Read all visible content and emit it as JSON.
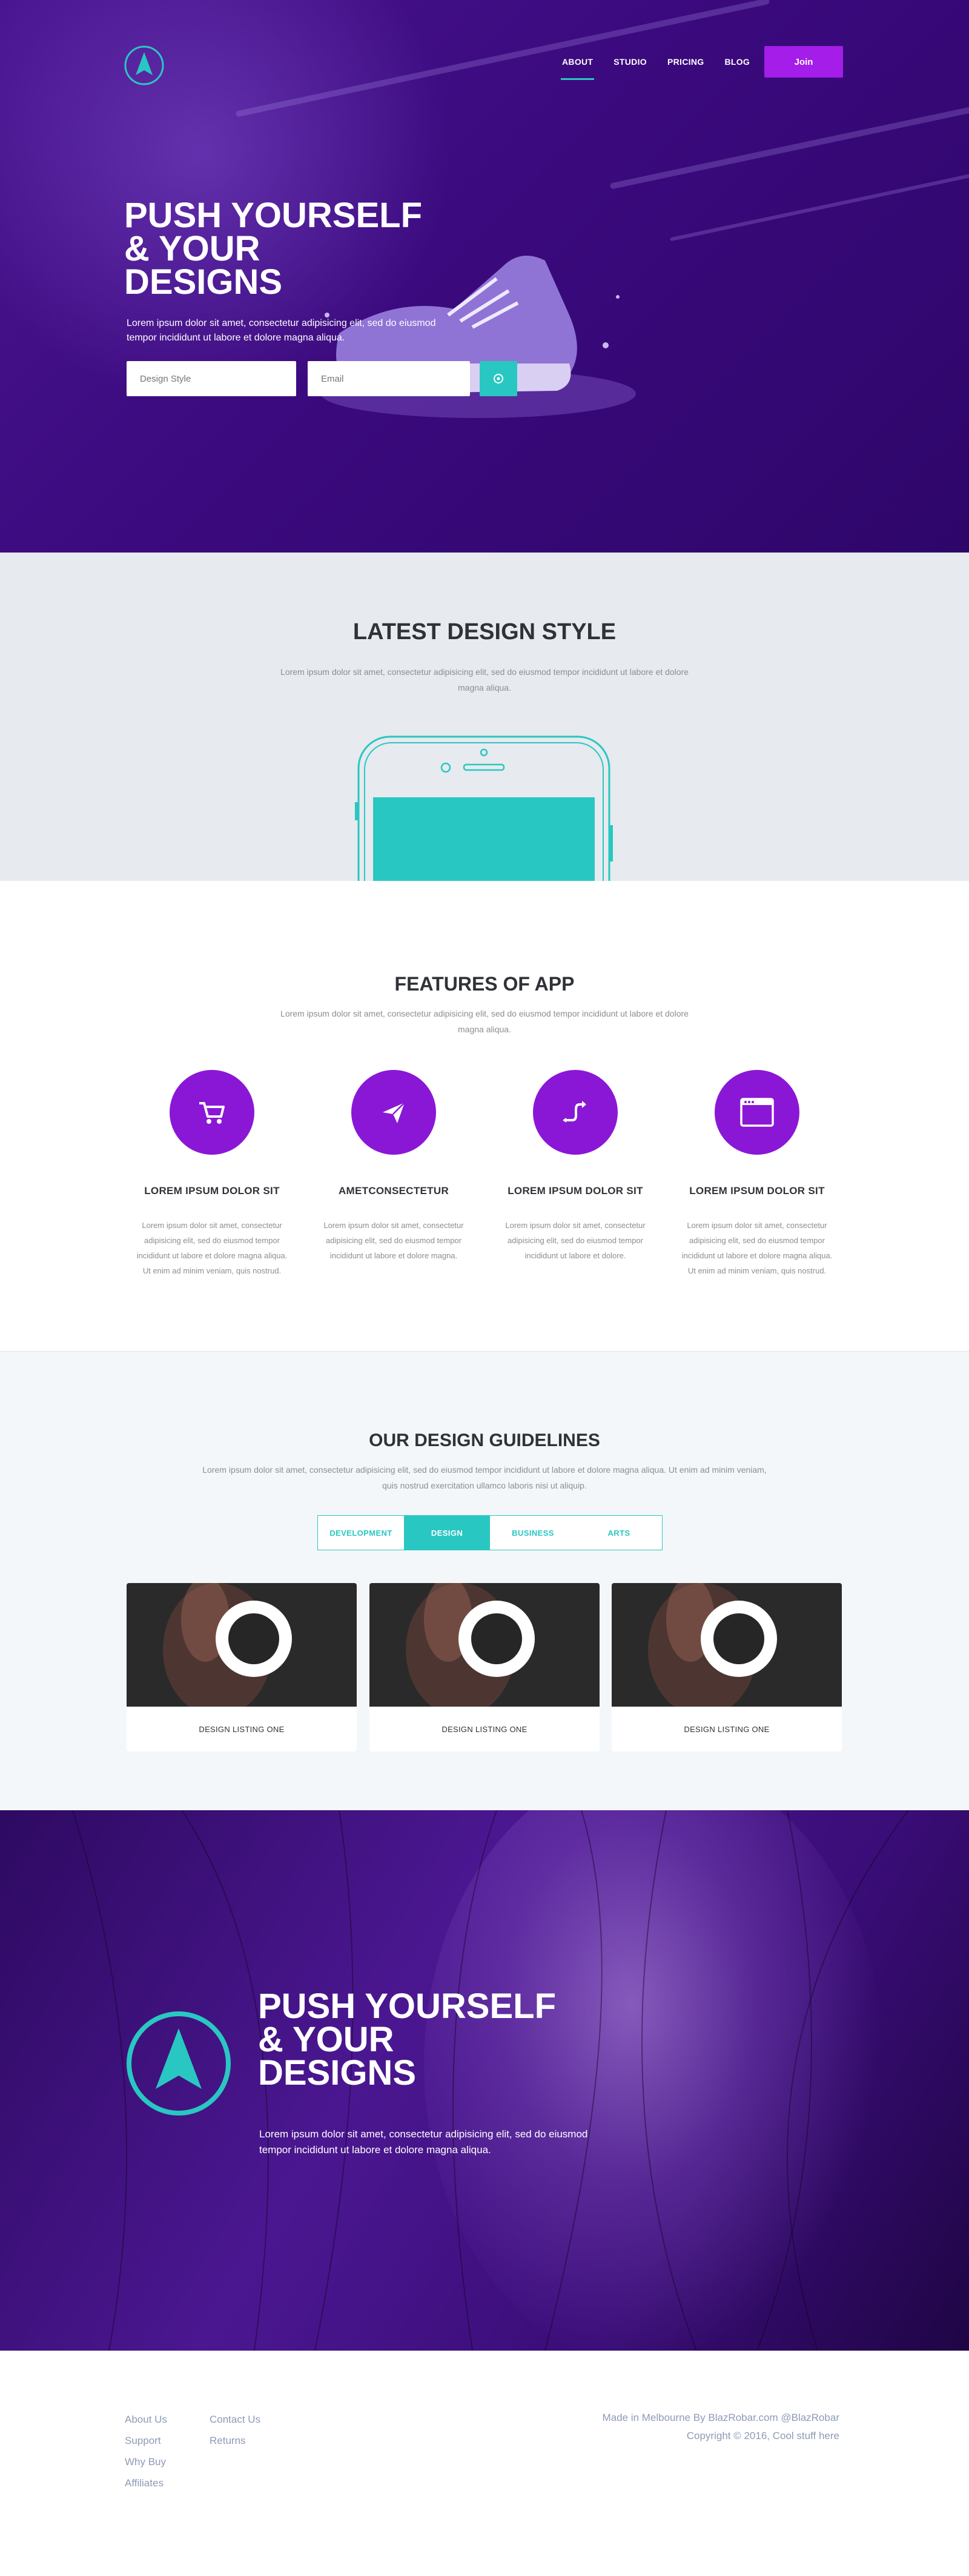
{
  "header": {
    "logo": "compass-arrow-logo",
    "nav": [
      {
        "label": "ABOUT",
        "active": true
      },
      {
        "label": "STUDIO",
        "active": false
      },
      {
        "label": "PRICING",
        "active": false
      },
      {
        "label": "BLOG",
        "active": false
      }
    ],
    "join_label": "Join"
  },
  "hero": {
    "title_lines": [
      "PUSH YOURSELF",
      "& YOUR",
      "DESIGNS"
    ],
    "text": "Lorem ipsum dolor sit amet, consectetur adipisicing elit, sed do eiusmod tempor incididunt ut labore et dolore magna aliqua.",
    "design_style_placeholder": "Design Style",
    "email_placeholder": "Email",
    "submit_icon": "target-icon"
  },
  "latest": {
    "title": "LATEST DESIGN STYLE",
    "subtitle": "Lorem ipsum dolor sit amet, consectetur adipisicing elit, sed do eiusmod tempor incididunt ut labore et dolore magna aliqua."
  },
  "features": {
    "title": "FEATURES OF APP",
    "subtitle": "Lorem ipsum dolor sit amet, consectetur adipisicing elit, sed do eiusmod tempor incididunt ut labore et dolore magna aliqua.",
    "items": [
      {
        "icon": "cart-icon",
        "title": "LOREM IPSUM DOLOR SIT",
        "text": "Lorem ipsum dolor sit amet, consectetur adipisicing elit, sed do eiusmod tempor incididunt ut labore et dolore magna aliqua. Ut enim ad minim veniam, quis nostrud."
      },
      {
        "icon": "paper-plane-icon",
        "title": "AMETCONSECTETUR",
        "text": "Lorem ipsum dolor sit amet, consectetur adipisicing elit, sed do eiusmod tempor incididunt ut labore et dolore magna."
      },
      {
        "icon": "shuffle-arrows-icon",
        "title": "LOREM IPSUM DOLOR SIT",
        "text": "Lorem ipsum dolor sit amet, consectetur adipisicing elit, sed do eiusmod tempor incididunt ut labore et dolore."
      },
      {
        "icon": "browser-window-icon",
        "title": "LOREM IPSUM DOLOR SIT",
        "text": "Lorem ipsum dolor sit amet, consectetur adipisicing elit, sed do eiusmod tempor incididunt ut labore et dolore magna aliqua. Ut enim ad minim veniam, quis nostrud."
      }
    ]
  },
  "guidelines": {
    "title": "OUR DESIGN GUIDELINES",
    "subtitle": "Lorem ipsum dolor sit amet, consectetur adipisicing elit, sed do eiusmod tempor incididunt ut labore et dolore magna aliqua. Ut enim ad minim veniam, quis nostrud exercitation ullamco laboris nisi ut aliquip.",
    "tabs": [
      {
        "label": "DEVELOPMENT",
        "active": false
      },
      {
        "label": "DESIGN",
        "active": true
      },
      {
        "label": "BUSINESS",
        "active": false
      },
      {
        "label": "ARTS",
        "active": false
      }
    ],
    "cards": [
      {
        "caption": "DESIGN LISTING  ONE"
      },
      {
        "caption": "DESIGN LISTING  ONE"
      },
      {
        "caption": "DESIGN LISTING  ONE"
      }
    ]
  },
  "cta": {
    "title_lines": [
      "PUSH YOURSELF",
      "& YOUR",
      "DESIGNS"
    ],
    "text": "Lorem ipsum dolor sit amet, consectetur adipisicing elit, sed do eiusmod tempor incididunt ut labore et dolore magna aliqua."
  },
  "footer": {
    "col1": [
      "About Us",
      "Support",
      "Why Buy",
      "Affiliates"
    ],
    "col2": [
      "Contact Us",
      "Returns"
    ],
    "credit": "Made in Melbourne By BlazRobar.com @BlazRobar",
    "copyright": "Copyright © 2016, Cool stuff here"
  },
  "colors": {
    "accent_teal": "#29c7c2",
    "accent_purple": "#8a17d6",
    "join_purple": "#a51de8",
    "hero_purple": "#3b0a7e",
    "footer_link": "#8c9bb5"
  }
}
